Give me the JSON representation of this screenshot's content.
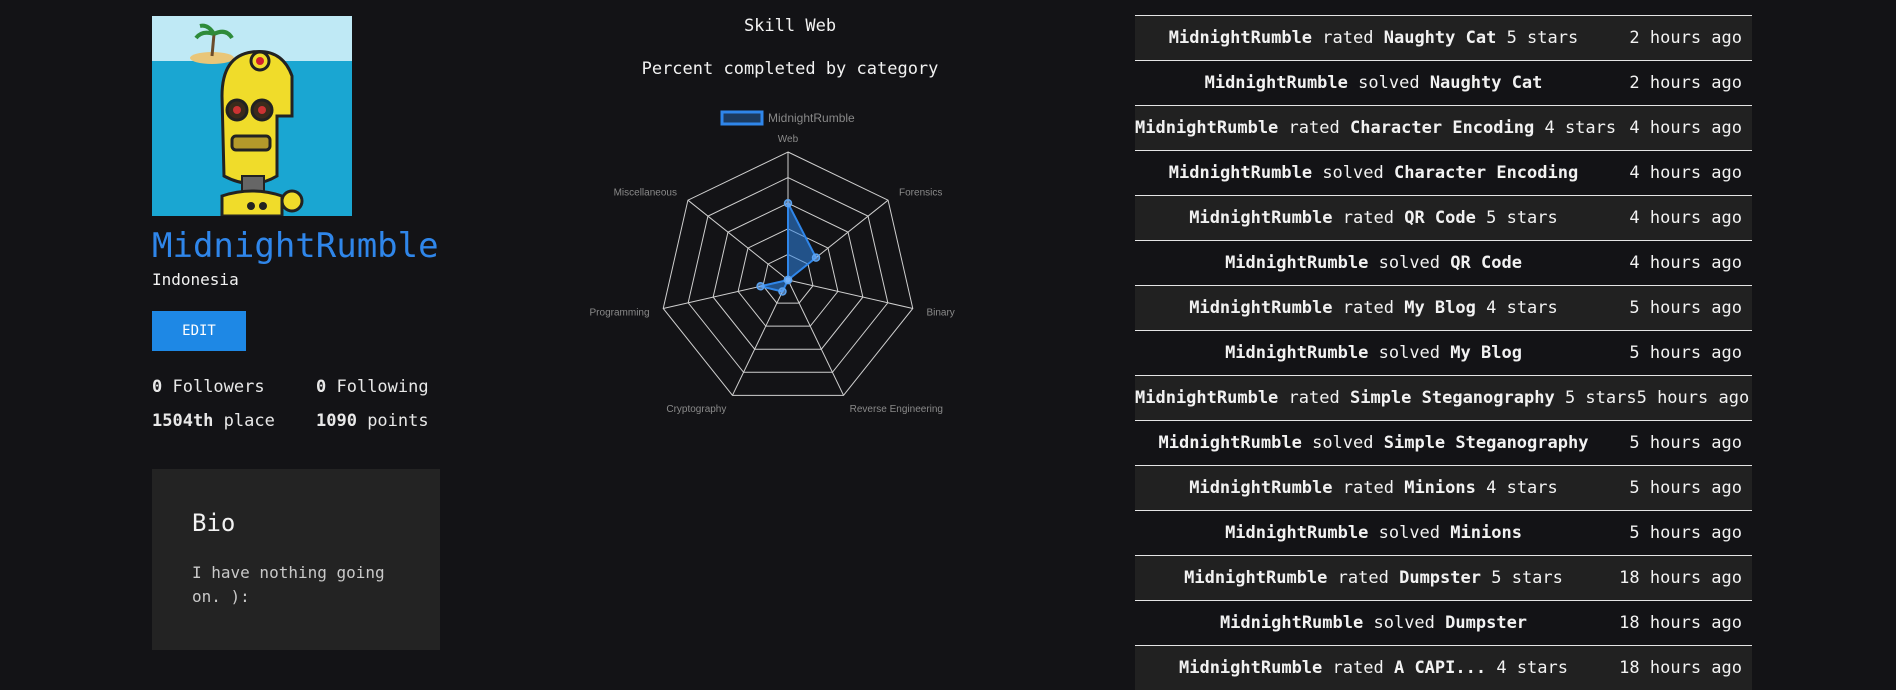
{
  "profile": {
    "username": "MidnightRumble",
    "country": "Indonesia",
    "edit_label": "EDIT",
    "followers_count": "0",
    "followers_label": " Followers",
    "following_count": "0",
    "following_label": " Following",
    "place_value": "1504th",
    "place_label": " place",
    "points_value": "1090",
    "points_label": " points",
    "accent_color": "#2f86ea"
  },
  "bio": {
    "title": "Bio",
    "text": "I have nothing going on. ):"
  },
  "chart": {
    "title": "Skill Web",
    "subtitle": "Percent completed by category"
  },
  "chart_data": {
    "type": "radar",
    "categories": [
      "Web",
      "Forensics",
      "Binary",
      "Reverse Engineering",
      "Cryptography",
      "Programming",
      "Miscellaneous"
    ],
    "series": [
      {
        "name": "MidnightRumble",
        "values": [
          60,
          28,
          0,
          0,
          10,
          22,
          0
        ],
        "color": "#2f86ea"
      }
    ],
    "rmax": 100,
    "ring_count": 5,
    "legend_position": "top"
  },
  "feed": [
    {
      "user": "MidnightRumble",
      "verb": "rated",
      "target": "Naughty Cat",
      "suffix": "5 stars",
      "time": "2 hours ago"
    },
    {
      "user": "MidnightRumble",
      "verb": "solved",
      "target": "Naughty Cat",
      "suffix": "",
      "time": "2 hours ago"
    },
    {
      "user": "MidnightRumble",
      "verb": "rated",
      "target": "Character Encoding",
      "suffix": "4 stars",
      "time": "4 hours ago"
    },
    {
      "user": "MidnightRumble",
      "verb": "solved",
      "target": "Character Encoding",
      "suffix": "",
      "time": "4 hours ago"
    },
    {
      "user": "MidnightRumble",
      "verb": "rated",
      "target": "QR Code",
      "suffix": "5 stars",
      "time": "4 hours ago"
    },
    {
      "user": "MidnightRumble",
      "verb": "solved",
      "target": "QR Code",
      "suffix": "",
      "time": "4 hours ago"
    },
    {
      "user": "MidnightRumble",
      "verb": "rated",
      "target": "My Blog",
      "suffix": "4 stars",
      "time": "5 hours ago"
    },
    {
      "user": "MidnightRumble",
      "verb": "solved",
      "target": "My Blog",
      "suffix": "",
      "time": "5 hours ago"
    },
    {
      "user": "MidnightRumble",
      "verb": "rated",
      "target": "Simple Steganography",
      "suffix": "5 stars",
      "time": "5 hours ago"
    },
    {
      "user": "MidnightRumble",
      "verb": "solved",
      "target": "Simple Steganography",
      "suffix": "",
      "time": "5 hours ago"
    },
    {
      "user": "MidnightRumble",
      "verb": "rated",
      "target": "Minions",
      "suffix": "4 stars",
      "time": "5 hours ago"
    },
    {
      "user": "MidnightRumble",
      "verb": "solved",
      "target": "Minions",
      "suffix": "",
      "time": "5 hours ago"
    },
    {
      "user": "MidnightRumble",
      "verb": "rated",
      "target": "Dumpster",
      "suffix": "5 stars",
      "time": "18 hours ago"
    },
    {
      "user": "MidnightRumble",
      "verb": "solved",
      "target": "Dumpster",
      "suffix": "",
      "time": "18 hours ago"
    },
    {
      "user": "MidnightRumble",
      "verb": "rated",
      "target": "A CAPI...",
      "suffix": "4 stars",
      "time": "18 hours ago"
    }
  ]
}
